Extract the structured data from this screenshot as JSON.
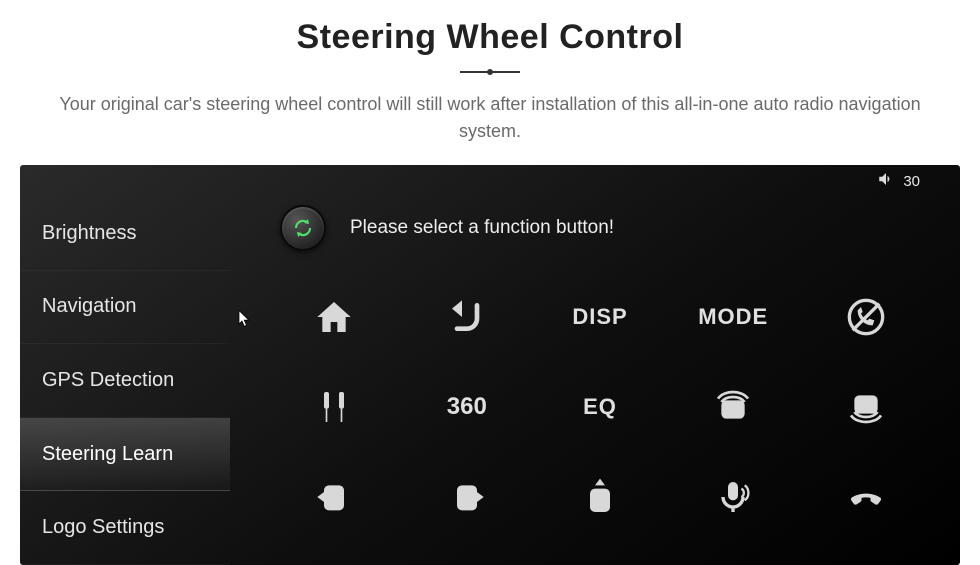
{
  "header": {
    "title": "Steering Wheel Control",
    "subtitle": "Your original car's steering wheel control will still work after installation of this all-in-one auto radio navigation system."
  },
  "status": {
    "volume_value": "30"
  },
  "sidebar": {
    "items": [
      {
        "label": "Brightness"
      },
      {
        "label": "Navigation"
      },
      {
        "label": "GPS Detection"
      },
      {
        "label": "Steering Learn"
      },
      {
        "label": "Logo Settings"
      }
    ],
    "active_index": 3
  },
  "main": {
    "prompt": "Please select a function button!",
    "buttons": {
      "home": "home",
      "back": "back",
      "disp": "DISP",
      "mode": "MODE",
      "three_sixty": "360",
      "eq": "EQ"
    }
  }
}
